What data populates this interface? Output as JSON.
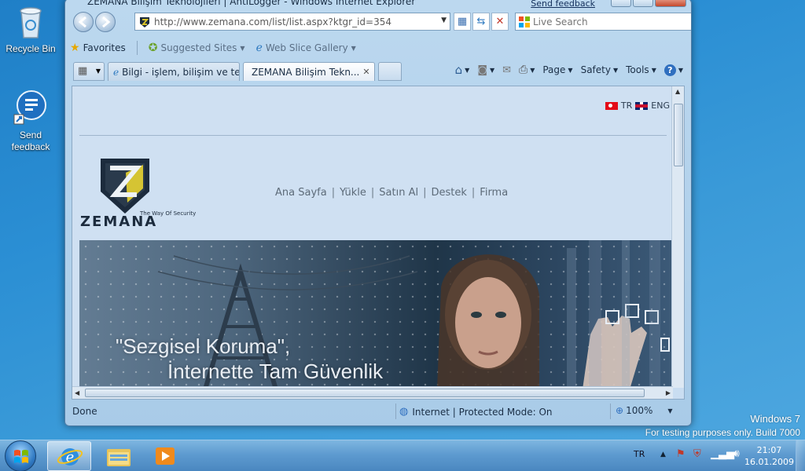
{
  "desktop": {
    "recycle_bin": "Recycle Bin",
    "send_feedback": "Send feedback",
    "watermark_line1": "Windows 7",
    "watermark_line2": "For testing purposes only. Build 7000"
  },
  "window": {
    "title": "ZEMANA Bilişim Teknolojileri | AntiLogger - Windows Internet Explorer",
    "send_feedback_link": "Send feedback",
    "address": "http://www.zemana.com/list/list.aspx?ktgr_id=354",
    "search_placeholder": "Live Search"
  },
  "favorites_bar": {
    "favorites": "Favorites",
    "suggested_sites": "Suggested Sites",
    "web_slice_gallery": "Web Slice Gallery"
  },
  "tabs": [
    {
      "label": "Bilgi - işlem, bilişim ve te..."
    },
    {
      "label": "ZEMANA Bilişim Tekn..."
    }
  ],
  "command_bar": {
    "page": "Page",
    "safety": "Safety",
    "tools": "Tools"
  },
  "site": {
    "lang_tr": "TR",
    "lang_en": "ENG",
    "brand": "ZEMANA",
    "tagline": "The Way Of Security",
    "nav": [
      "Ana Sayfa",
      "Yükle",
      "Satın Al",
      "Destek",
      "Firma"
    ],
    "slogan_line1": "\"Sezgisel Koruma\",",
    "slogan_line2": "İnternette Tam Güvenlik"
  },
  "status_bar": {
    "status": "Done",
    "zone": "Internet | Protected Mode: On",
    "zoom": "100%"
  },
  "taskbar": {
    "language": "TR",
    "time": "21:07",
    "date": "16.01.2009"
  }
}
